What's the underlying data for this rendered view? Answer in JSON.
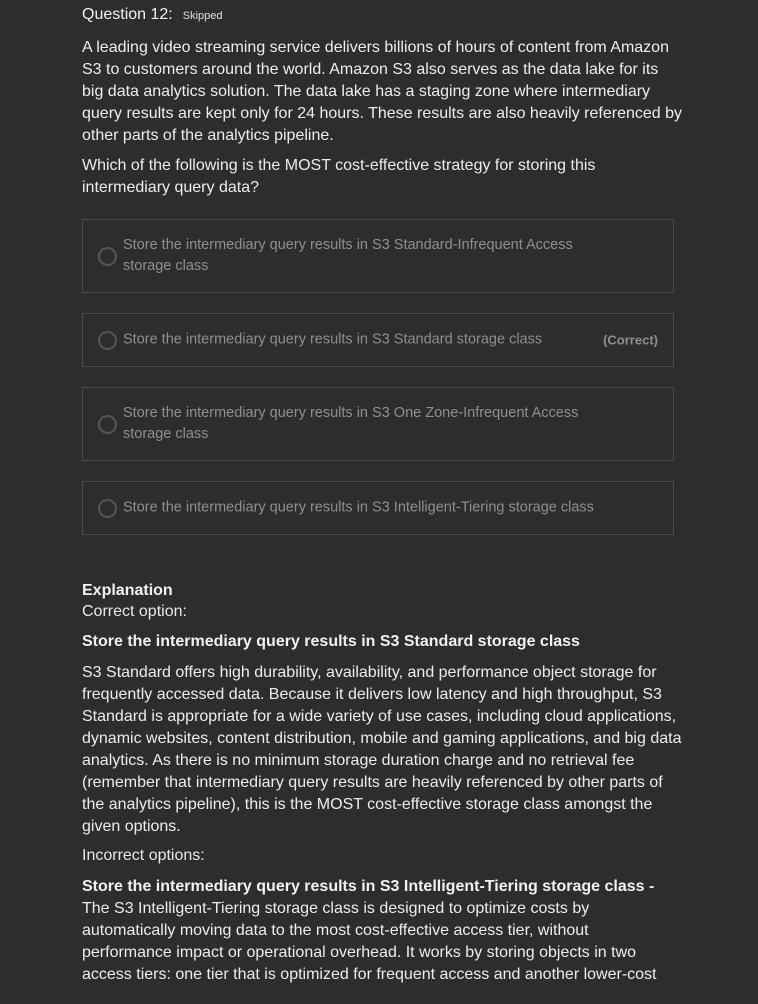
{
  "question": {
    "title": "Question 12:",
    "status": "Skipped",
    "text": "A leading video streaming service delivers billions of hours of content from Amazon S3 to customers around the world. Amazon S3 also serves as the data lake for its big data analytics solution. The data lake has a staging zone where intermediary query results are kept only for 24 hours. These results are also heavily referenced by other parts of the analytics pipeline.",
    "prompt": "Which of the following is the MOST cost-effective strategy for storing this intermediary query data?"
  },
  "options": [
    {
      "label": "Store the intermediary query results in S3 Standard-Infrequent Access storage class",
      "tag": ""
    },
    {
      "label": "Store the intermediary query results in S3 Standard storage class",
      "tag": "(Correct)"
    },
    {
      "label": "Store the intermediary query results in S3 One Zone-Infrequent Access storage class",
      "tag": ""
    },
    {
      "label": "Store the intermediary query results in S3 Intelligent-Tiering storage class",
      "tag": ""
    }
  ],
  "explanation": {
    "heading": "Explanation",
    "correct_label": "Correct option:",
    "correct_answer": "Store the intermediary query results in S3 Standard storage class",
    "body": "S3 Standard offers high durability, availability, and performance object storage for frequently accessed data. Because it delivers low latency and high throughput, S3 Standard is appropriate for a wide variety of use cases, including cloud applications, dynamic websites, content distribution, mobile and gaming applications, and big data analytics. As there is no minimum storage duration charge and no retrieval fee (remember that intermediary query results are heavily referenced by other parts of the analytics pipeline), this is the MOST cost-effective storage class amongst the given options.",
    "incorrect_label": "Incorrect options:",
    "incorrect_title": "Store the intermediary query results in S3 Intelligent-Tiering storage class",
    "incorrect_sep": " - ",
    "incorrect_body": "The S3 Intelligent-Tiering storage class is designed to optimize costs by automatically moving data to the most cost-effective access tier, without performance impact or operational overhead. It works by storing objects in two access tiers: one tier that is optimized for frequent access and another lower-cost"
  }
}
